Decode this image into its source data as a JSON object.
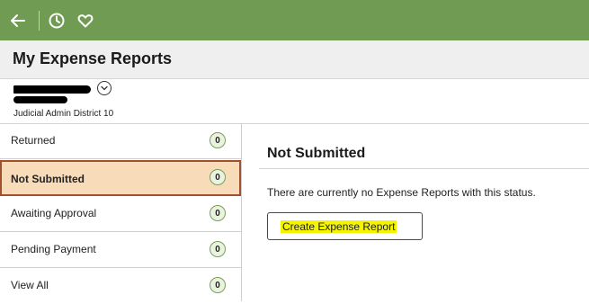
{
  "header": {
    "icons": [
      "back-arrow-icon",
      "history-clock-icon",
      "favorites-heart-icon"
    ],
    "color": "#6f9c52"
  },
  "page": {
    "title": "My Expense Reports"
  },
  "user": {
    "district": "Judicial Admin District 10"
  },
  "sidebar": {
    "items": [
      {
        "label": "Returned",
        "count": "0"
      },
      {
        "label": "Not Submitted",
        "count": "0",
        "selected": true
      },
      {
        "label": "Awaiting Approval",
        "count": "0"
      },
      {
        "label": "Pending Payment",
        "count": "0"
      },
      {
        "label": "View All",
        "count": "0"
      }
    ]
  },
  "main": {
    "heading": "Not Submitted",
    "message": "There are currently no Expense Reports with this status.",
    "create_button": "Create Expense Report"
  }
}
